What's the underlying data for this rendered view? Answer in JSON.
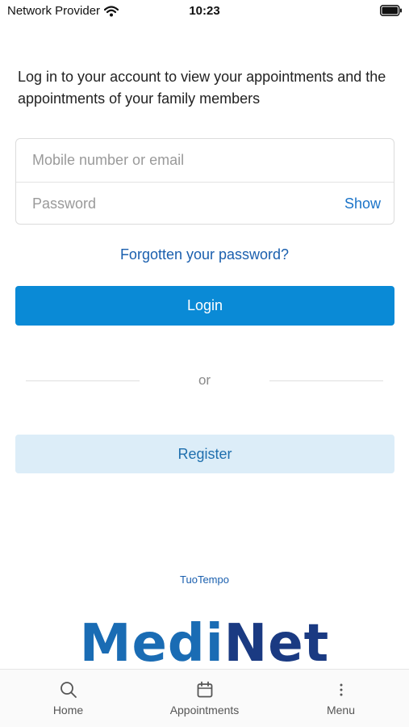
{
  "status_bar": {
    "carrier": "Network Provider",
    "time": "10:23"
  },
  "login": {
    "intro": "Log in to your account to view your appointments and the appointments of your family members",
    "identifier_placeholder": "Mobile number or email",
    "password_placeholder": "Password",
    "show_label": "Show",
    "forgot_label": "Forgotten your password?",
    "login_label": "Login",
    "or_label": "or",
    "register_label": "Register"
  },
  "brand": {
    "provider": "TuoTempo",
    "logo_part1": "Medi",
    "logo_part2": "Net"
  },
  "bottom_nav": {
    "items": [
      {
        "label": "Home",
        "icon": "search-icon"
      },
      {
        "label": "Appointments",
        "icon": "calendar-icon"
      },
      {
        "label": "Menu",
        "icon": "more-vertical-icon"
      }
    ]
  },
  "colors": {
    "primary": "#0a8ad6",
    "link": "#1a5fae",
    "secondary_bg": "#dcedf8"
  }
}
